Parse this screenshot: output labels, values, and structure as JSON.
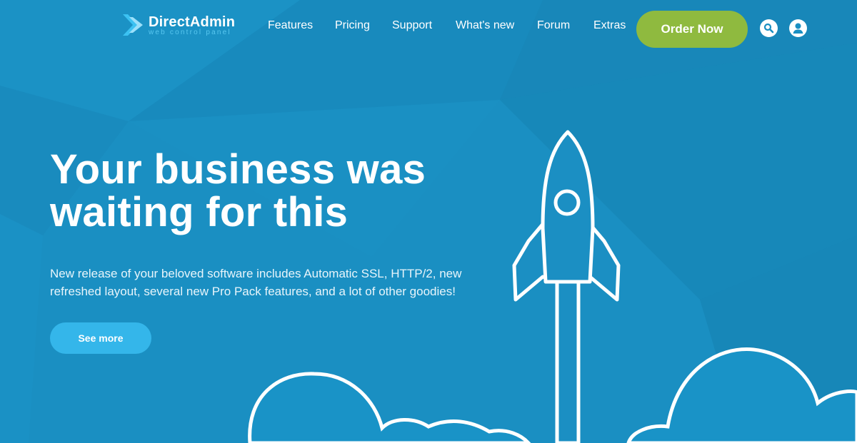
{
  "logo": {
    "name": "DirectAdmin",
    "tagline": "web control panel"
  },
  "nav": {
    "items": [
      {
        "label": "Features"
      },
      {
        "label": "Pricing"
      },
      {
        "label": "Support"
      },
      {
        "label": "What's new"
      },
      {
        "label": "Forum"
      },
      {
        "label": "Extras"
      }
    ],
    "order_button": "Order Now",
    "search_icon": "search-icon",
    "account_icon": "user-icon"
  },
  "hero": {
    "title_line1": "Your business was",
    "title_line2": "waiting for this",
    "description_line1": "New release of your beloved software includes Automatic SSL, HTTP/2, new",
    "description_line2": "refreshed layout, several new Pro Pack features, and a lot of other goodies!",
    "cta": "See more"
  },
  "colors": {
    "background": "#1a8fc2",
    "accent_green": "#8fba3f",
    "button_blue": "#34b6ea",
    "logo_light": "#58c7f0"
  }
}
